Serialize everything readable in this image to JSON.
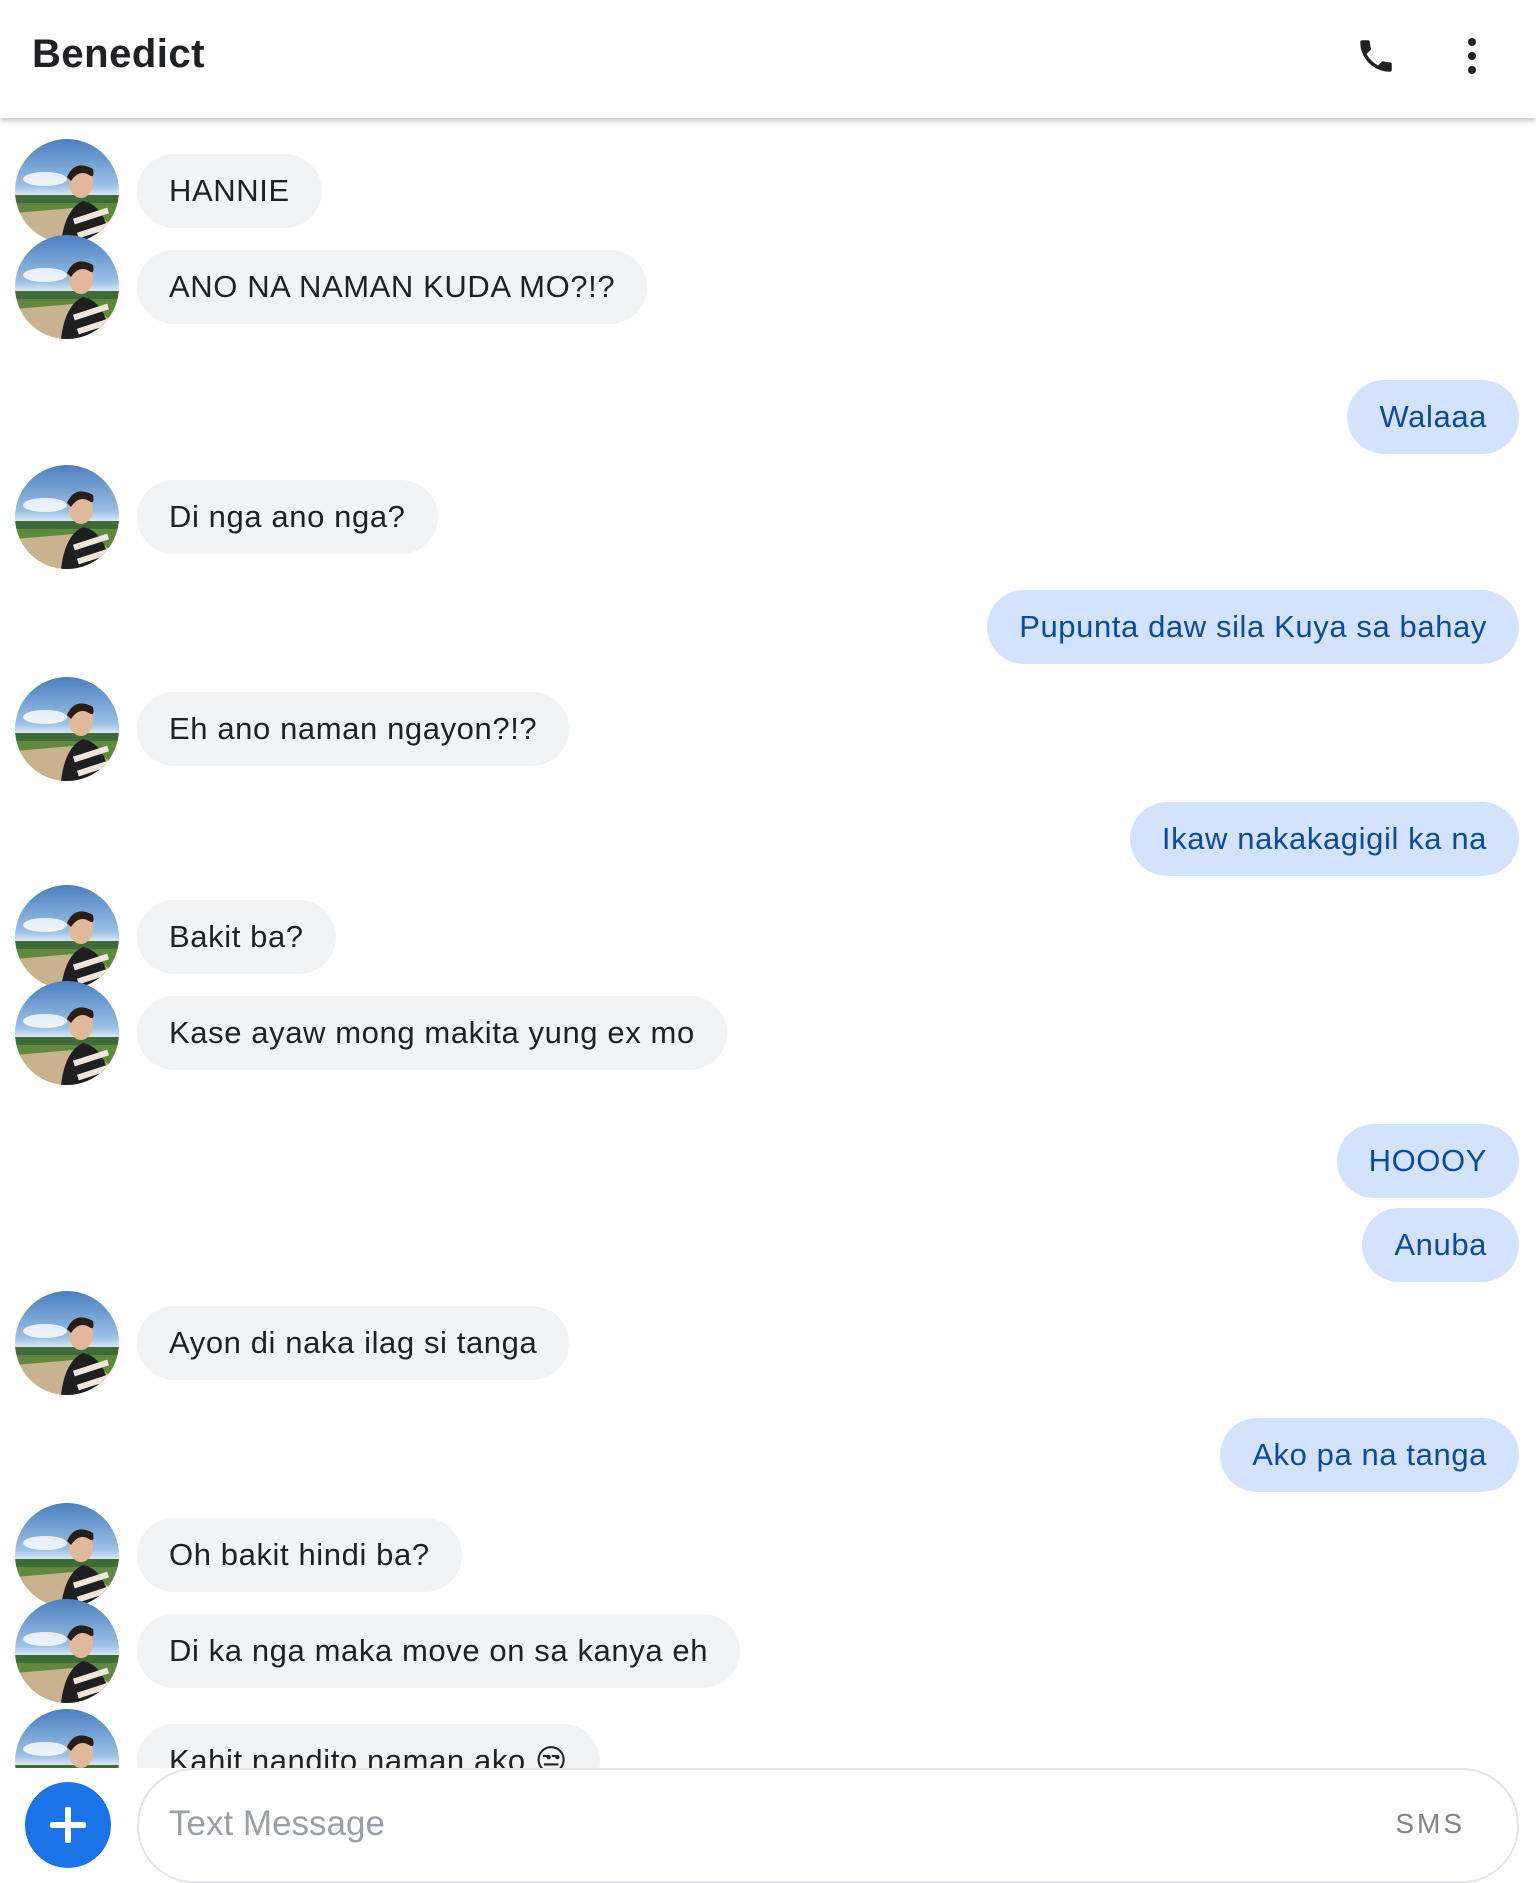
{
  "header": {
    "contact_name": "Benedict",
    "call_icon": "phone-icon",
    "menu_icon": "more-vert-icon"
  },
  "messages": [
    {
      "dir": "in",
      "text": "HANNIE"
    },
    {
      "dir": "in",
      "text": "ANO NA NAMAN KUDA MO?!?"
    },
    {
      "dir": "out",
      "text": "Walaaa"
    },
    {
      "dir": "in",
      "text": "Di nga ano nga?"
    },
    {
      "dir": "out",
      "text": "Pupunta daw sila Kuya sa bahay"
    },
    {
      "dir": "in",
      "text": "Eh ano naman ngayon?!?"
    },
    {
      "dir": "out",
      "text": "Ikaw nakakagigil ka na"
    },
    {
      "dir": "in",
      "text": "Bakit ba?"
    },
    {
      "dir": "in",
      "text": "Kase ayaw mong makita yung ex mo"
    },
    {
      "dir": "out",
      "text": "HOOOY"
    },
    {
      "dir": "out",
      "text": "Anuba"
    },
    {
      "dir": "in",
      "text": "Ayon di naka ilag si tanga"
    },
    {
      "dir": "out",
      "text": "Ako pa na tanga"
    },
    {
      "dir": "in",
      "text": "Oh bakit hindi ba?"
    },
    {
      "dir": "in",
      "text": "Di ka nga maka move on sa kanya eh"
    },
    {
      "dir": "in",
      "text": "Kahit nandito naman ako 😒"
    }
  ],
  "composer": {
    "placeholder": "Text Message",
    "mode_label": "SMS",
    "add_icon": "plus-icon"
  }
}
